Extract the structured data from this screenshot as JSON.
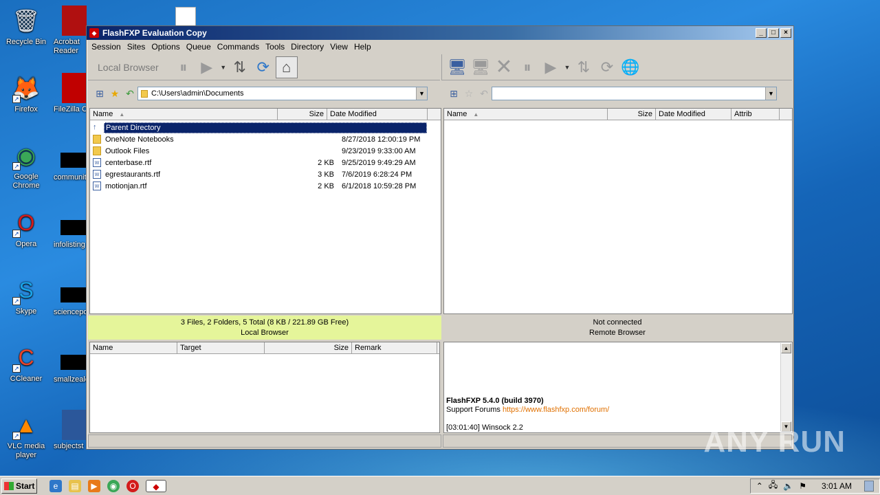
{
  "desktop": {
    "icons": [
      {
        "label": "Recycle Bin",
        "glyph": "🗑",
        "color": "#cfd8e3"
      },
      {
        "label": "Firefox",
        "glyph": "🦊",
        "color": "#ff7a1a"
      },
      {
        "label": "Google Chrome",
        "glyph": "◉",
        "color": "#3aa757"
      },
      {
        "label": "Opera",
        "glyph": "O",
        "color": "#d31b1b"
      },
      {
        "label": "Skype",
        "glyph": "S",
        "color": "#1aa3e8"
      },
      {
        "label": "CCleaner",
        "glyph": "C",
        "color": "#e8442a"
      },
      {
        "label": "VLC media player",
        "glyph": "▲",
        "color": "#ff8800"
      }
    ],
    "col2": [
      {
        "label": "Acrobat Reader"
      },
      {
        "label": "FileZilla C"
      },
      {
        "label": "communit"
      },
      {
        "label": "infolisting"
      },
      {
        "label": "sciencepo"
      },
      {
        "label": "smallzeale"
      },
      {
        "label": "subjectst"
      }
    ]
  },
  "window": {
    "title": "FlashFXP Evaluation Copy",
    "menu": [
      "Session",
      "Sites",
      "Options",
      "Queue",
      "Commands",
      "Tools",
      "Directory",
      "View",
      "Help"
    ],
    "local_label": "Local Browser",
    "local_path": "C:\\Users\\admin\\Documents",
    "remote_path": "",
    "local_columns": [
      "Name",
      "Size",
      "Date Modified"
    ],
    "remote_columns": [
      "Name",
      "Size",
      "Date Modified",
      "Attrib"
    ],
    "local_files": [
      {
        "name": "Parent Directory",
        "size": "",
        "date": "",
        "type": "up"
      },
      {
        "name": "OneNote Notebooks",
        "size": "",
        "date": "8/27/2018 12:00:19 PM",
        "type": "folder"
      },
      {
        "name": "Outlook Files",
        "size": "",
        "date": "9/23/2019 9:33:00 AM",
        "type": "folder"
      },
      {
        "name": "centerbase.rtf",
        "size": "2 KB",
        "date": "9/25/2019 9:49:29 AM",
        "type": "doc"
      },
      {
        "name": "egrestaurants.rtf",
        "size": "3 KB",
        "date": "7/6/2019 6:28:24 PM",
        "type": "doc"
      },
      {
        "name": "motionjan.rtf",
        "size": "2 KB",
        "date": "6/1/2018 10:59:28 PM",
        "type": "doc"
      }
    ],
    "local_status": "3 Files, 2 Folders, 5 Total (8 KB / 221.89 GB Free)",
    "local_status_label": "Local Browser",
    "remote_status": "Not connected",
    "remote_status_label": "Remote Browser",
    "queue_columns": [
      "Name",
      "Target",
      "Size",
      "Remark"
    ],
    "log": {
      "title": "FlashFXP 5.4.0 (build 3970)",
      "support_label": "Support Forums",
      "support_link": "https://www.flashfxp.com/forum/",
      "line": "[03:01:40]  Winsock 2.2"
    }
  },
  "taskbar": {
    "start": "Start",
    "clock": "3:01 AM"
  },
  "watermark": "ANY RUN",
  "colors": {
    "selection": "#0a246a",
    "local_status_bg": "#e5f59a"
  }
}
